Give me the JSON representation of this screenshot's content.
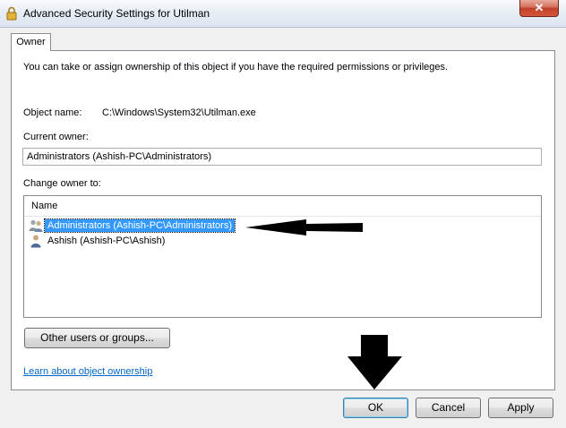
{
  "window": {
    "title": "Advanced Security Settings for Utilman",
    "close_glyph": "✕"
  },
  "tabs": [
    {
      "label": "Owner"
    }
  ],
  "owner": {
    "intro": "You can take or assign ownership of this object if you have the required permissions or privileges.",
    "object_name_label": "Object name:",
    "object_name_value": "C:\\Windows\\System32\\Utilman.exe",
    "current_owner_label": "Current owner:",
    "current_owner_value": "Administrators (Ashish-PC\\Administrators)",
    "change_owner_label": "Change owner to:",
    "list": {
      "column_header": "Name",
      "items": [
        {
          "label": "Administrators (Ashish-PC\\Administrators)",
          "icon": "group-users-icon",
          "selected": true
        },
        {
          "label": "Ashish (Ashish-PC\\Ashish)",
          "icon": "user-icon",
          "selected": false
        }
      ]
    },
    "other_users_button": "Other users or groups...",
    "learn_link": "Learn about object ownership"
  },
  "footer": {
    "ok": "OK",
    "cancel": "Cancel",
    "apply": "Apply"
  },
  "colors": {
    "selection": "#3399ff",
    "link": "#0066cc",
    "annotation_arrows": "#000000"
  }
}
